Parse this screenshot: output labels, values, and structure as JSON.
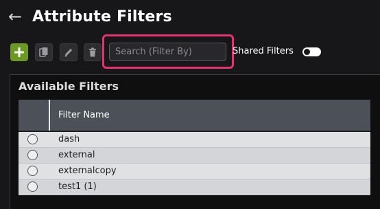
{
  "header": {
    "back_icon": "arrow-left-icon",
    "title": "Attribute Filters"
  },
  "toolbar": {
    "add_icon": "plus-icon",
    "copy_icon": "copy-icon",
    "edit_icon": "pencil-icon",
    "delete_icon": "trash-icon",
    "search_placeholder": "Search (Filter By)",
    "search_value": "",
    "shared_filters_label": "Shared Filters",
    "shared_filters_on": false
  },
  "panel": {
    "title": "Available Filters",
    "columns": [
      "",
      "Filter Name"
    ],
    "rows": [
      {
        "name": "dash",
        "selected": false
      },
      {
        "name": "external",
        "selected": false
      },
      {
        "name": "externalcopy",
        "selected": false
      },
      {
        "name": "test1 (1)",
        "selected": false
      }
    ]
  },
  "colors": {
    "add_button": "#6a9a22",
    "highlight": "#e8326f",
    "background": "#17171a"
  }
}
